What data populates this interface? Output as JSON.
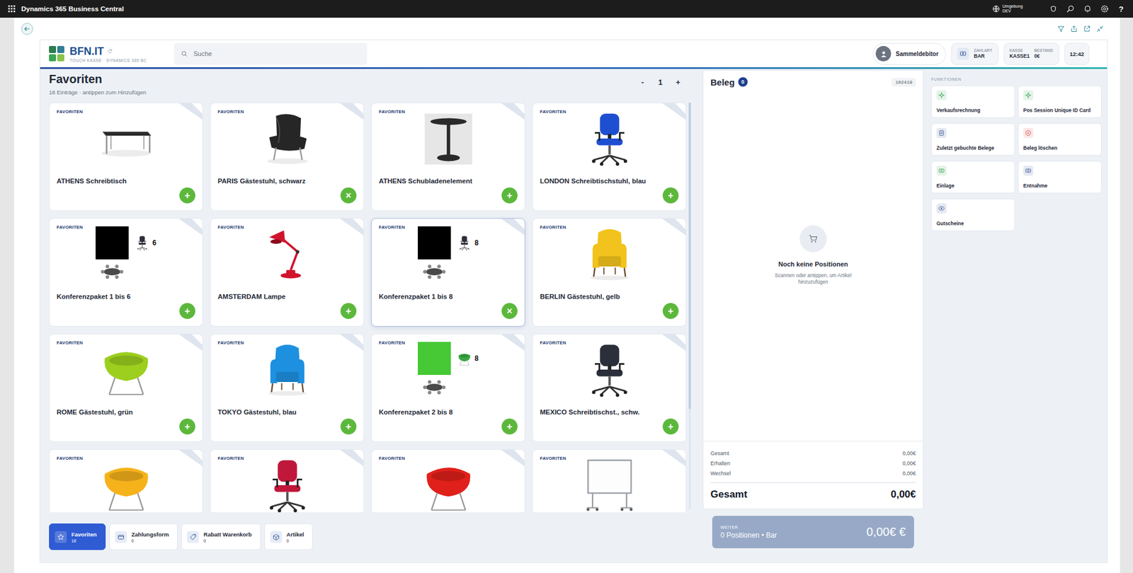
{
  "app_bar": {
    "title": "Dynamics 365 Business Central",
    "environment": {
      "label": "Umgebung",
      "value": "DEV"
    },
    "help": "?"
  },
  "pos_header": {
    "brand": "BFN.IT",
    "subtitle": "TOUCH KASSE · DYNAMICS 365 BC",
    "search": {
      "placeholder": "Suche"
    },
    "customer": "Sammeldebitor",
    "payment": {
      "label": "ZAHLART",
      "value": "BAR"
    },
    "register": [
      {
        "label": "KASSE",
        "value": "KASSE1"
      },
      {
        "label": "BESTAND",
        "value": "0€"
      }
    ],
    "time": "12:42"
  },
  "favorites": {
    "title": "Favoriten",
    "subtitle": "18 Einträge · antippen zum Hinzufügen",
    "quantity": {
      "decrease": "-",
      "value": "1",
      "increase": "+"
    },
    "items": [
      {
        "tag": "FAVORITEN",
        "name": "ATHENS Schreibtisch",
        "picture": {
          "kind": "desk",
          "color": "#2a2a2a"
        },
        "action": "+",
        "hovered": false
      },
      {
        "tag": "FAVORITEN",
        "name": "PARIS Gästestuhl, schwarz",
        "picture": {
          "kind": "lounge",
          "color": "#262626"
        },
        "action": "×",
        "hovered": false
      },
      {
        "tag": "FAVORITEN",
        "name": "ATHENS Schubladenelement",
        "picture": {
          "kind": "pedestal",
          "color": "#2a2a2a"
        },
        "action": "+",
        "hovered": false
      },
      {
        "tag": "FAVORITEN",
        "name": "LONDON Schreibtischstuhl, blau",
        "picture": {
          "kind": "office-chair",
          "color": "#1f4fd1"
        },
        "action": "+",
        "hovered": false
      },
      {
        "tag": "FAVORITEN",
        "name": "Konferenzpaket 1 bis 6",
        "picture": {
          "kind": "bundle",
          "color": "#000000",
          "count": "6",
          "chair": "office-chair",
          "chair_color": "#2b2f3a"
        },
        "action": "+",
        "hovered": false
      },
      {
        "tag": "FAVORITEN",
        "name": "AMSTERDAM Lampe",
        "picture": {
          "kind": "lamp",
          "color": "#d0142c"
        },
        "action": "+",
        "hovered": false
      },
      {
        "tag": "FAVORITEN",
        "name": "Konferenzpaket 1 bis 8",
        "picture": {
          "kind": "bundle",
          "color": "#000000",
          "count": "8",
          "chair": "office-chair",
          "chair_color": "#2b2f3a"
        },
        "action": "×",
        "hovered": true
      },
      {
        "tag": "FAVORITEN",
        "name": "BERLIN Gästestuhl, gelb",
        "picture": {
          "kind": "armchair",
          "color": "#f2c31c"
        },
        "action": "+",
        "hovered": false
      },
      {
        "tag": "FAVORITEN",
        "name": "ROME Gästestuhl, grün",
        "picture": {
          "kind": "egg",
          "color": "#9ccf1e"
        },
        "action": "+",
        "hovered": false
      },
      {
        "tag": "FAVORITEN",
        "name": "TOKYO Gästestuhl, blau",
        "picture": {
          "kind": "armchair",
          "color": "#1e90e0"
        },
        "action": "+",
        "hovered": false
      },
      {
        "tag": "FAVORITEN",
        "name": "Konferenzpaket 2 bis 8",
        "picture": {
          "kind": "bundle",
          "color": "#46c935",
          "count": "8",
          "chair": "egg",
          "chair_color": "#3aa845"
        },
        "action": "+",
        "hovered": false
      },
      {
        "tag": "FAVORITEN",
        "name": "MEXICO Schreibtischst., schw.",
        "picture": {
          "kind": "office-chair",
          "color": "#2b2f3a"
        },
        "action": "+",
        "hovered": false
      },
      {
        "tag": "FAVORITEN",
        "picture": {
          "kind": "egg",
          "color": "#f5b21b"
        },
        "hovered": false
      },
      {
        "tag": "FAVORITEN",
        "picture": {
          "kind": "office-chair",
          "color": "#c0183a"
        },
        "hovered": false
      },
      {
        "tag": "FAVORITEN",
        "picture": {
          "kind": "egg",
          "color": "#e0201a"
        },
        "hovered": false
      },
      {
        "tag": "FAVORITEN",
        "picture": {
          "kind": "whiteboard",
          "color": "#9aa0a6"
        },
        "hovered": false
      }
    ]
  },
  "bottom_tabs": [
    {
      "label": "Favoriten",
      "count": "18",
      "icon": "star",
      "selected": true
    },
    {
      "label": "Zahlungsform",
      "count": "0",
      "icon": "card",
      "selected": false
    },
    {
      "label": "Rabatt Warenkorb",
      "count": "0",
      "icon": "tag",
      "selected": false
    },
    {
      "label": "Artikel",
      "count": "0",
      "icon": "box",
      "selected": false
    }
  ],
  "receipt": {
    "title": "Beleg",
    "count": "0",
    "number": "102419",
    "empty": {
      "title": "Noch keine Positionen",
      "hint": "Scannen oder antippen, um Artikel hinzuzufügen"
    },
    "totals": [
      {
        "label": "Gesamt",
        "value": "0,00€"
      },
      {
        "label": "Erhalten",
        "value": "0,00€"
      },
      {
        "label": "Wechsel",
        "value": "0,00€"
      }
    ],
    "grand_total": {
      "label": "Gesamt",
      "value": "0,00€"
    },
    "checkout": {
      "label": "WEITER",
      "summary": "0 Positionen • Bar",
      "amount": "0,00€ €",
      "disabled": true
    }
  },
  "functions": {
    "title": "FUNKTIONEN",
    "items": [
      {
        "label": "Verkaufsrechnung",
        "kind": "sparkle",
        "color": "#3aa655"
      },
      {
        "label": "Pos Session Unique ID Card",
        "kind": "sparkle",
        "color": "#3aa655"
      },
      {
        "label": "Zuletzt gebuchte Belege",
        "kind": "document",
        "color": "#3d5a99"
      },
      {
        "label": "Beleg löschen",
        "kind": "delete",
        "color": "#d9534f"
      },
      {
        "label": "Einlage",
        "kind": "cash",
        "color": "#3aa655"
      },
      {
        "label": "Entnahme",
        "kind": "cash",
        "color": "#3d5a99"
      },
      {
        "label": "Gutscheine",
        "kind": "voucher",
        "color": "#3d5a99"
      }
    ]
  }
}
